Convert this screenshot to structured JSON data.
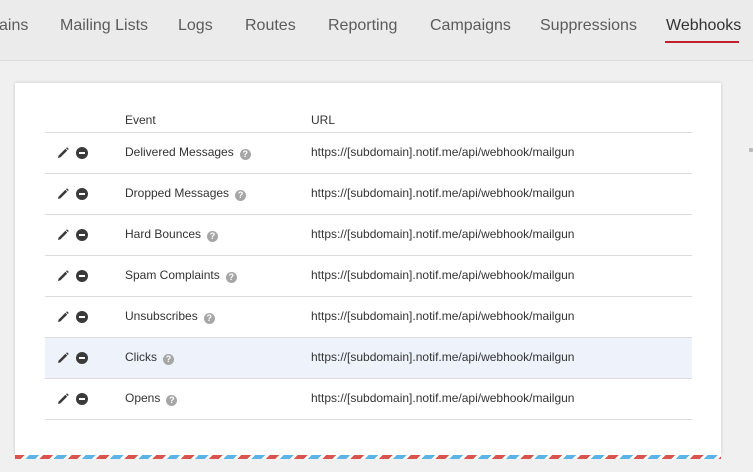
{
  "nav": {
    "items": [
      {
        "label": "ains"
      },
      {
        "label": "Mailing Lists"
      },
      {
        "label": "Logs"
      },
      {
        "label": "Routes"
      },
      {
        "label": "Reporting"
      },
      {
        "label": "Campaigns"
      },
      {
        "label": "Suppressions"
      },
      {
        "label": "Webhooks"
      }
    ],
    "active": "Webhooks"
  },
  "colors": {
    "accent": "#c3202f",
    "row_highlight": "#eef3fb",
    "airmail_red": "#d9534f",
    "airmail_blue": "#5bb3e6"
  },
  "table": {
    "headers": {
      "event": "Event",
      "url": "URL"
    },
    "help_glyph": "?",
    "rows": [
      {
        "event": "Delivered Messages",
        "url": "https://[subdomain].notif.me/api/webhook/mailgun"
      },
      {
        "event": "Dropped Messages",
        "url": "https://[subdomain].notif.me/api/webhook/mailgun"
      },
      {
        "event": "Hard Bounces",
        "url": "https://[subdomain].notif.me/api/webhook/mailgun"
      },
      {
        "event": "Spam Complaints",
        "url": "https://[subdomain].notif.me/api/webhook/mailgun"
      },
      {
        "event": "Unsubscribes",
        "url": "https://[subdomain].notif.me/api/webhook/mailgun"
      },
      {
        "event": "Clicks",
        "url": "https://[subdomain].notif.me/api/webhook/mailgun"
      },
      {
        "event": "Opens",
        "url": "https://[subdomain].notif.me/api/webhook/mailgun"
      }
    ],
    "icons": {
      "edit": "pencil-icon",
      "remove": "minus-circle-icon",
      "help": "question-icon"
    }
  }
}
